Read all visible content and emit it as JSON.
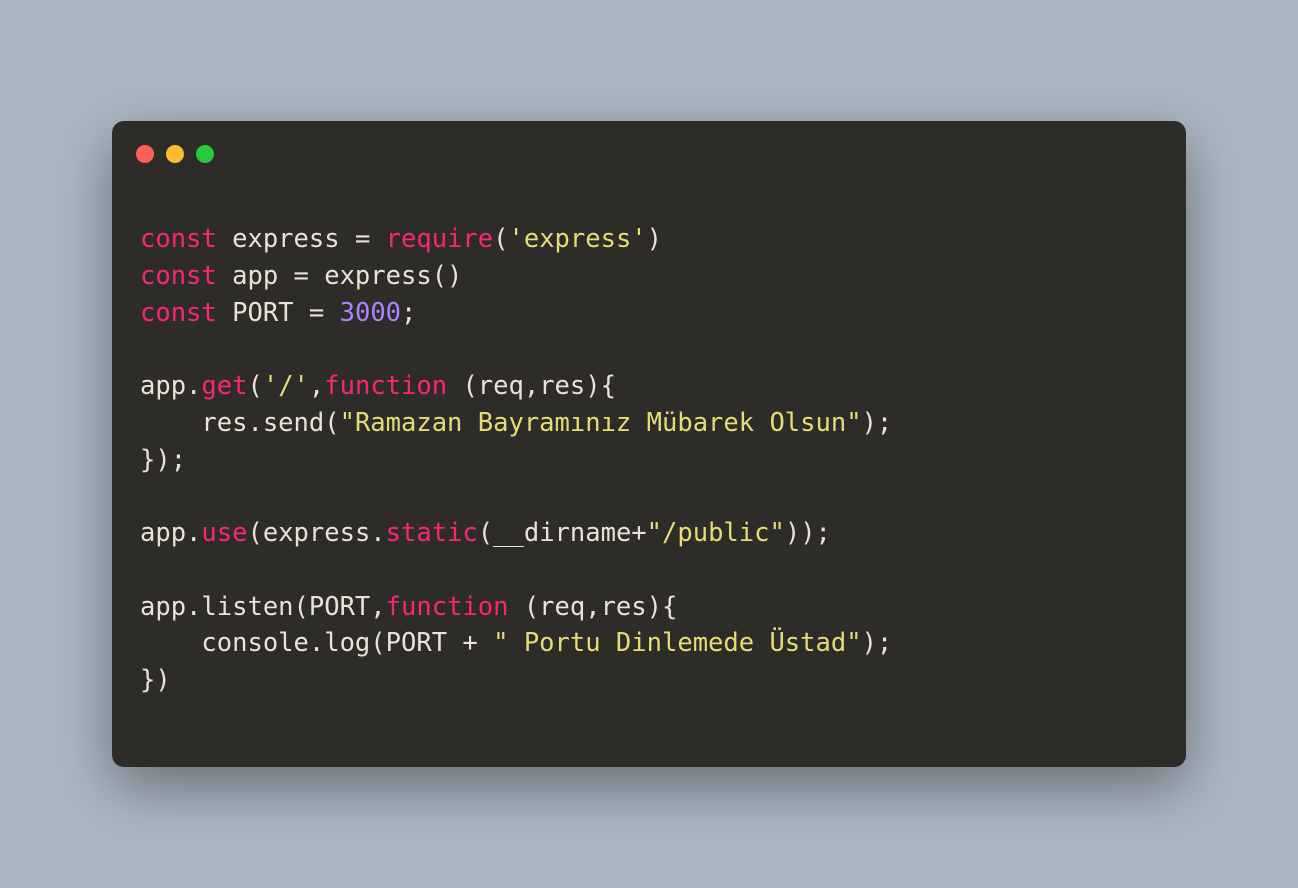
{
  "code": {
    "l1": {
      "const": "const",
      "express": " express ",
      "eq": "=",
      "require": " require",
      "paren_open": "(",
      "str": "'express'",
      "paren_close": ")"
    },
    "l2": {
      "const": "const",
      "rest": " app = express()"
    },
    "l3": {
      "const": "const",
      "port_label": " PORT ",
      "eq": "=",
      "sp": " ",
      "num": "3000",
      "semi": ";"
    },
    "l5": {
      "pre": "app.",
      "get": "get",
      "paren": "(",
      "str": "'/'",
      "comma": ",",
      "func": "function",
      "rest": " (req,res){"
    },
    "l6": {
      "pre": "    res.send(",
      "str": "\"Ramazan Bayramınız Mübarek Olsun\"",
      "post": ");"
    },
    "l7": {
      "txt": "});"
    },
    "l9": {
      "pre": "app.",
      "use": "use",
      "mid": "(express.",
      "static": "static",
      "open": "(__dirname+",
      "str": "\"/public\"",
      "post": "));"
    },
    "l11": {
      "pre": "app.listen(PORT,",
      "func": "function",
      "rest": " (req,res){"
    },
    "l12": {
      "pre": "    console.log(PORT + ",
      "str": "\" Portu Dinlemede Üstad\"",
      "post": ");"
    },
    "l13": {
      "txt": "})"
    }
  }
}
